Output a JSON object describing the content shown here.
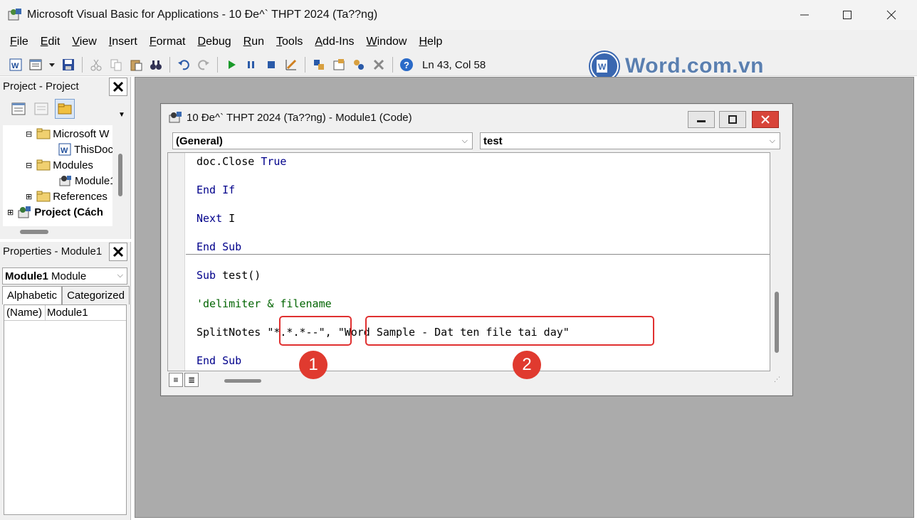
{
  "window": {
    "title": "Microsoft Visual Basic for Applications - 10 Đe^` THPT 2024 (Ta??ng)"
  },
  "menu": [
    "File",
    "Edit",
    "View",
    "Insert",
    "Format",
    "Debug",
    "Run",
    "Tools",
    "Add-Ins",
    "Window",
    "Help"
  ],
  "toolbar": {
    "status": "Ln 43, Col 58"
  },
  "logo": {
    "text": "Word.com.vn"
  },
  "project_pane": {
    "title": "Project - Project",
    "tree": [
      {
        "label": "Microsoft W",
        "icon": "folder-icon"
      },
      {
        "label": "ThisDoc",
        "icon": "word-doc-icon"
      },
      {
        "label": "Modules",
        "icon": "folder-icon"
      },
      {
        "label": "Module1",
        "icon": "module-icon"
      },
      {
        "label": "References",
        "icon": "folder-icon"
      },
      {
        "label": "Project (Cách",
        "icon": "project-icon"
      }
    ]
  },
  "properties_pane": {
    "title": "Properties - Module1",
    "object_name": "Module1",
    "object_type": "Module",
    "tabs": [
      "Alphabetic",
      "Categorized"
    ],
    "rows": [
      {
        "key": "(Name)",
        "value": "Module1"
      }
    ]
  },
  "code_window": {
    "title": "10 Đe^` THPT 2024 (Ta??ng) - Module1 (Code)",
    "object_combo": "(General)",
    "proc_combo": "test",
    "lines": {
      "l1_a": "doc.Close ",
      "l1_b": "True",
      "l2": "End If",
      "l3_a": "Next",
      "l3_b": " I",
      "l4": "End Sub",
      "l5_a": "Sub",
      "l5_b": " test()",
      "l6": "'delimiter & filename",
      "l7_a": "SplitNotes ",
      "l7_b": "\"*.*.*--\"",
      "l7_c": ", ",
      "l7_d": "\"Word Sample - Dat ten file tai day\"",
      "l8": "End Sub"
    }
  },
  "annotations": {
    "badge1": "1",
    "badge2": "2",
    "color": "#e03a2f"
  },
  "colors": {
    "keyword": "#00008b",
    "comment": "#006400",
    "mdi_bg": "#ababab"
  }
}
